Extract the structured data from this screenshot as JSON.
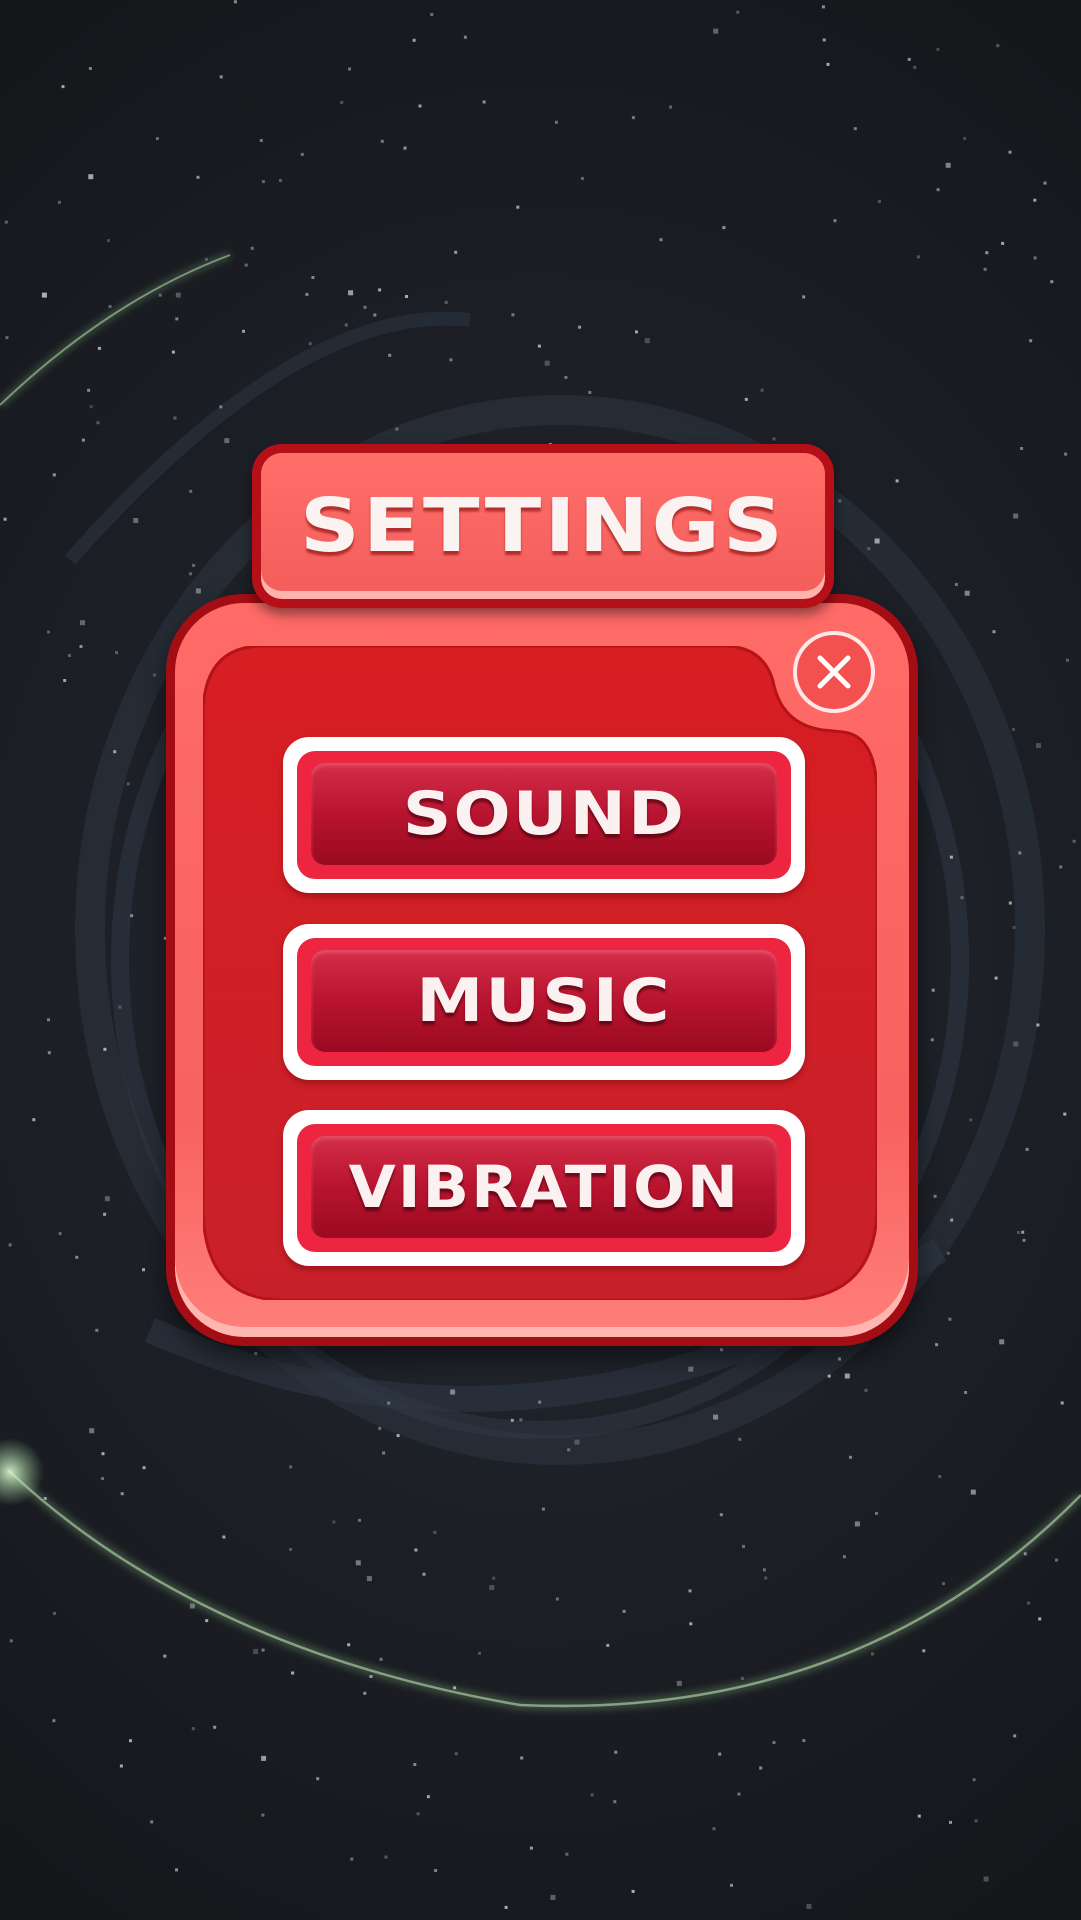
{
  "screen": {
    "title": "SETTINGS",
    "close_icon": "close-icon"
  },
  "menu": {
    "items": [
      {
        "id": "sound",
        "label": "SOUND"
      },
      {
        "id": "music",
        "label": "MUSIC"
      },
      {
        "id": "vibration",
        "label": "VIBRATION"
      }
    ]
  },
  "colors": {
    "background": "#1b1e24",
    "panel": "#f8625f",
    "panel_border": "#a40d14",
    "panel_inner": "#d11f25",
    "button_face": "#b8142f",
    "button_ring": "#ee2540",
    "text": "#fbf2f2",
    "orbit_glow": "#9fd39a"
  }
}
